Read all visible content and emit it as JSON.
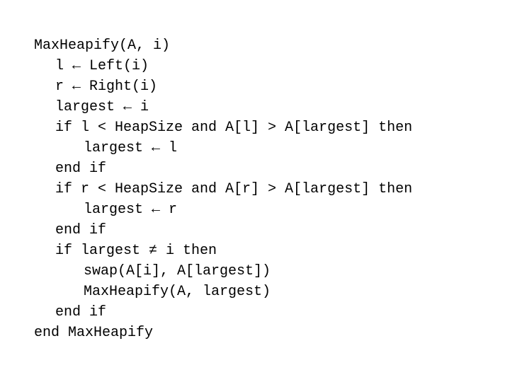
{
  "document": {
    "kind": "pseudocode-listing",
    "algorithm_name": "MaxHeapify",
    "background_color": "#ffffff",
    "text_color": "#000000"
  },
  "symbols": {
    "assign_arrow": "←",
    "not_equal": "≠",
    "less_than": "<",
    "greater_than": ">"
  },
  "code": {
    "lines": [
      {
        "indent": 0,
        "text": "MaxHeapify(A, i)"
      },
      {
        "indent": 1,
        "text": "l ← Left(i)"
      },
      {
        "indent": 1,
        "text": "r ← Right(i)"
      },
      {
        "indent": 1,
        "text": "largest ← i"
      },
      {
        "indent": 1,
        "text": "if l < HeapSize and A[l] > A[largest] then"
      },
      {
        "indent": 2,
        "text": "largest ← l"
      },
      {
        "indent": 1,
        "text": "end if"
      },
      {
        "indent": 1,
        "text": "if r < HeapSize and A[r] > A[largest] then"
      },
      {
        "indent": 2,
        "text": "largest ← r"
      },
      {
        "indent": 1,
        "text": "end if"
      },
      {
        "indent": 1,
        "text": "if largest ≠ i then"
      },
      {
        "indent": 2,
        "text": "swap(A[i], A[largest])"
      },
      {
        "indent": 2,
        "text": "MaxHeapify(A, largest)"
      },
      {
        "indent": 1,
        "text": "end if"
      },
      {
        "indent": 0,
        "text": "end MaxHeapify"
      }
    ]
  }
}
